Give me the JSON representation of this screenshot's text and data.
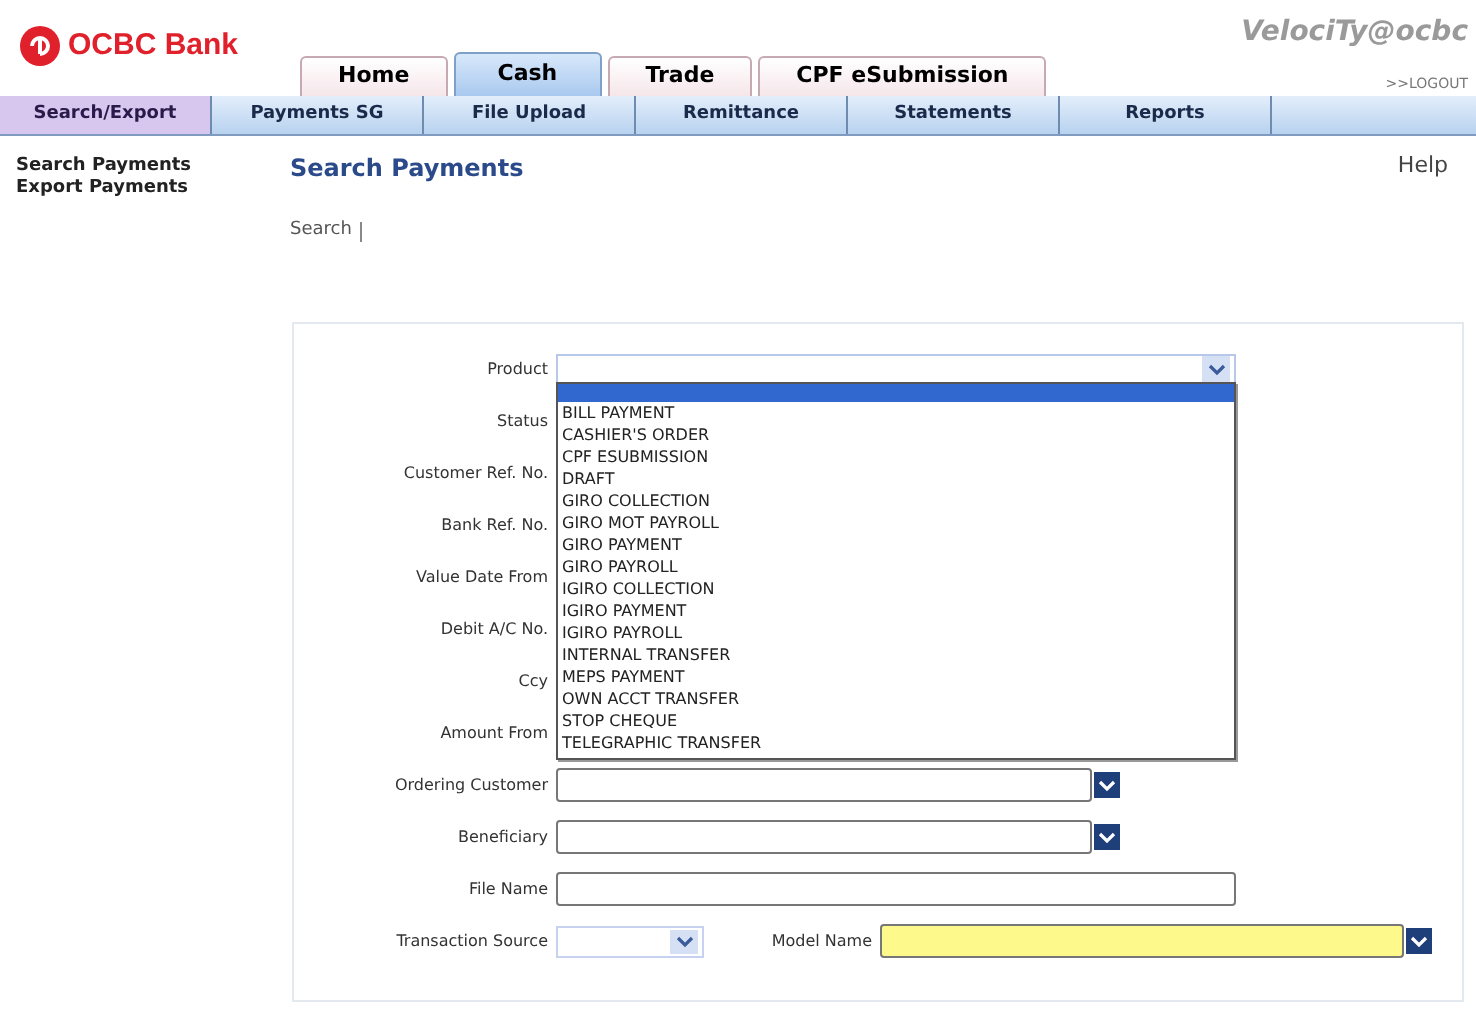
{
  "header": {
    "logo": "OCBC Bank",
    "brand": "VelociTy@ocbc",
    "logout": ">>LOGOUT"
  },
  "tabs": [
    {
      "label": "Home",
      "selected": false
    },
    {
      "label": "Cash",
      "selected": true
    },
    {
      "label": "Trade",
      "selected": false
    },
    {
      "label": "CPF eSubmission",
      "selected": false
    }
  ],
  "subnav": [
    {
      "label": "Search/Export",
      "selected": true
    },
    {
      "label": "Payments SG",
      "selected": false
    },
    {
      "label": "File Upload",
      "selected": false
    },
    {
      "label": "Remittance",
      "selected": false
    },
    {
      "label": "Statements",
      "selected": false
    },
    {
      "label": "Reports",
      "selected": false
    }
  ],
  "sidebar": {
    "items": [
      {
        "label": "Search Payments"
      },
      {
        "label": "Export Payments"
      }
    ]
  },
  "page": {
    "title": "Search Payments",
    "help": "Help",
    "breadcrumb": "Search"
  },
  "form": {
    "rows": [
      {
        "fields": [
          {
            "label": "Product",
            "kind": "select",
            "expanded": true,
            "options": [
              "BILL PAYMENT",
              "CASHIER'S ORDER",
              "CPF ESUBMISSION",
              "DRAFT",
              "GIRO COLLECTION",
              "GIRO MOT PAYROLL",
              "GIRO PAYMENT",
              "GIRO PAYROLL",
              "IGIRO COLLECTION",
              "IGIRO PAYMENT",
              "IGIRO PAYROLL",
              "INTERNAL TRANSFER",
              "MEPS PAYMENT",
              "OWN ACCT TRANSFER",
              "STOP CHEQUE",
              "TELEGRAPHIC TRANSFER"
            ]
          }
        ]
      },
      {
        "fields": [
          {
            "label": "Status",
            "kind": "covered"
          }
        ]
      },
      {
        "fields": [
          {
            "label": "Customer Ref. No.",
            "kind": "covered"
          }
        ]
      },
      {
        "fields": [
          {
            "label": "Bank Ref. No.",
            "kind": "covered"
          }
        ]
      },
      {
        "fields": [
          {
            "label": "Value Date From",
            "kind": "covered"
          }
        ]
      },
      {
        "fields": [
          {
            "label": "Debit A/C No.",
            "kind": "covered"
          }
        ]
      },
      {
        "fields": [
          {
            "label": "Ccy",
            "kind": "covered"
          }
        ]
      },
      {
        "fields": [
          {
            "label": "Amount From",
            "kind": "covered"
          }
        ]
      },
      {
        "fields": [
          {
            "label": "Ordering Customer",
            "kind": "lookup",
            "required": false
          }
        ]
      },
      {
        "fields": [
          {
            "label": "Beneficiary",
            "kind": "lookup",
            "required": false
          }
        ]
      },
      {
        "fields": [
          {
            "label": "File Name",
            "kind": "text"
          }
        ]
      },
      {
        "fields": [
          {
            "label": "Transaction Source",
            "kind": "small_select"
          },
          {
            "label": "Model Name",
            "kind": "lookup",
            "required": true
          }
        ]
      }
    ]
  }
}
